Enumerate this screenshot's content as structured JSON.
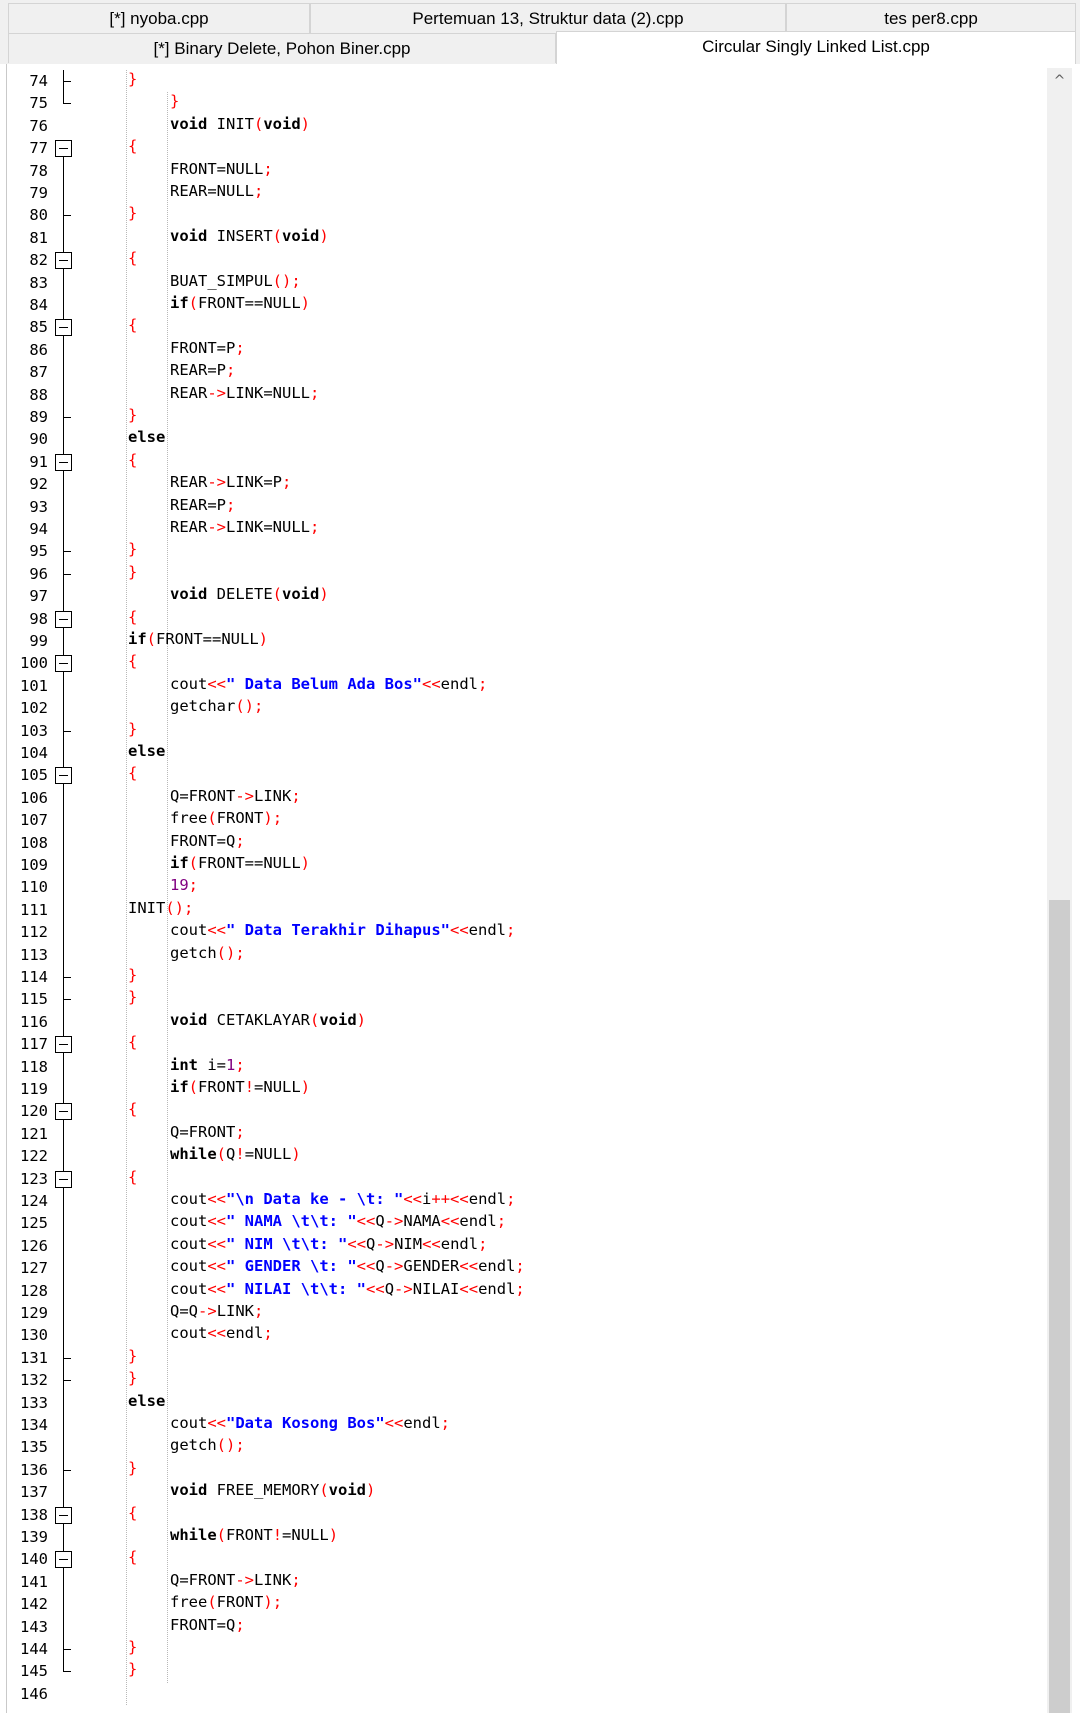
{
  "tabs": {
    "row1": [
      "[*] nyoba.cpp",
      "Pertemuan 13, Struktur data (2).cpp",
      "tes per8.cpp"
    ],
    "row2": [
      "[*] Binary Delete, Pohon Biner.cpp",
      "Circular Singly Linked List.cpp"
    ],
    "active": "Circular Singly Linked List.cpp"
  },
  "scrollbar": {
    "up_arrow": "^"
  },
  "editor": {
    "first_line_number": 74,
    "lines": [
      {
        "n": 74,
        "indent": 1,
        "text": "}"
      },
      {
        "n": 75,
        "indent": 2,
        "text": "}"
      },
      {
        "n": 76,
        "indent": 2,
        "text": "void INIT(void)"
      },
      {
        "n": 77,
        "indent": 1,
        "text": "{"
      },
      {
        "n": 78,
        "indent": 2,
        "text": "FRONT=NULL;"
      },
      {
        "n": 79,
        "indent": 2,
        "text": "REAR=NULL;"
      },
      {
        "n": 80,
        "indent": 1,
        "text": "}"
      },
      {
        "n": 81,
        "indent": 2,
        "text": "void INSERT(void)"
      },
      {
        "n": 82,
        "indent": 1,
        "text": "{"
      },
      {
        "n": 83,
        "indent": 2,
        "text": "BUAT_SIMPUL();"
      },
      {
        "n": 84,
        "indent": 2,
        "text": "if(FRONT==NULL)"
      },
      {
        "n": 85,
        "indent": 1,
        "text": "{"
      },
      {
        "n": 86,
        "indent": 2,
        "text": "FRONT=P;"
      },
      {
        "n": 87,
        "indent": 2,
        "text": "REAR=P;"
      },
      {
        "n": 88,
        "indent": 2,
        "text": "REAR->LINK=NULL;"
      },
      {
        "n": 89,
        "indent": 1,
        "text": "}"
      },
      {
        "n": 90,
        "indent": 1,
        "text": "else"
      },
      {
        "n": 91,
        "indent": 1,
        "text": "{"
      },
      {
        "n": 92,
        "indent": 2,
        "text": "REAR->LINK=P;"
      },
      {
        "n": 93,
        "indent": 2,
        "text": "REAR=P;"
      },
      {
        "n": 94,
        "indent": 2,
        "text": "REAR->LINK=NULL;"
      },
      {
        "n": 95,
        "indent": 1,
        "text": "}"
      },
      {
        "n": 96,
        "indent": 1,
        "text": "}"
      },
      {
        "n": 97,
        "indent": 2,
        "text": "void DELETE(void)"
      },
      {
        "n": 98,
        "indent": 1,
        "text": "{"
      },
      {
        "n": 99,
        "indent": 1,
        "text": "if(FRONT==NULL)"
      },
      {
        "n": 100,
        "indent": 1,
        "text": "{"
      },
      {
        "n": 101,
        "indent": 2,
        "text": "cout<<\" Data Belum Ada Bos\"<<endl;"
      },
      {
        "n": 102,
        "indent": 2,
        "text": "getchar();"
      },
      {
        "n": 103,
        "indent": 1,
        "text": "}"
      },
      {
        "n": 104,
        "indent": 1,
        "text": "else"
      },
      {
        "n": 105,
        "indent": 1,
        "text": "{"
      },
      {
        "n": 106,
        "indent": 2,
        "text": "Q=FRONT->LINK;"
      },
      {
        "n": 107,
        "indent": 2,
        "text": "free(FRONT);"
      },
      {
        "n": 108,
        "indent": 2,
        "text": "FRONT=Q;"
      },
      {
        "n": 109,
        "indent": 2,
        "text": "if(FRONT==NULL)"
      },
      {
        "n": 110,
        "indent": 2,
        "text": "19;"
      },
      {
        "n": 111,
        "indent": 1,
        "text": "INIT();"
      },
      {
        "n": 112,
        "indent": 2,
        "text": "cout<<\" Data Terakhir Dihapus\"<<endl;"
      },
      {
        "n": 113,
        "indent": 2,
        "text": "getch();"
      },
      {
        "n": 114,
        "indent": 1,
        "text": "}"
      },
      {
        "n": 115,
        "indent": 1,
        "text": "}"
      },
      {
        "n": 116,
        "indent": 2,
        "text": "void CETAKLAYAR(void)"
      },
      {
        "n": 117,
        "indent": 1,
        "text": "{"
      },
      {
        "n": 118,
        "indent": 2,
        "text": "int i=1;"
      },
      {
        "n": 119,
        "indent": 2,
        "text": "if(FRONT!=NULL)"
      },
      {
        "n": 120,
        "indent": 1,
        "text": "{"
      },
      {
        "n": 121,
        "indent": 2,
        "text": "Q=FRONT;"
      },
      {
        "n": 122,
        "indent": 2,
        "text": "while(Q!=NULL)"
      },
      {
        "n": 123,
        "indent": 1,
        "text": "{"
      },
      {
        "n": 124,
        "indent": 2,
        "text": "cout<<\"\\n Data ke - \\t: \"<<i++<<endl;"
      },
      {
        "n": 125,
        "indent": 2,
        "text": "cout<<\" NAMA \\t\\t: \"<<Q->NAMA<<endl;"
      },
      {
        "n": 126,
        "indent": 2,
        "text": "cout<<\" NIM \\t\\t: \"<<Q->NIM<<endl;"
      },
      {
        "n": 127,
        "indent": 2,
        "text": "cout<<\" GENDER \\t: \"<<Q->GENDER<<endl;"
      },
      {
        "n": 128,
        "indent": 2,
        "text": "cout<<\" NILAI \\t\\t: \"<<Q->NILAI<<endl;"
      },
      {
        "n": 129,
        "indent": 2,
        "text": "Q=Q->LINK;"
      },
      {
        "n": 130,
        "indent": 2,
        "text": "cout<<endl;"
      },
      {
        "n": 131,
        "indent": 1,
        "text": "}"
      },
      {
        "n": 132,
        "indent": 1,
        "text": "}"
      },
      {
        "n": 133,
        "indent": 1,
        "text": "else"
      },
      {
        "n": 134,
        "indent": 2,
        "text": "cout<<\"Data Kosong Bos\"<<endl;"
      },
      {
        "n": 135,
        "indent": 2,
        "text": "getch();"
      },
      {
        "n": 136,
        "indent": 1,
        "text": "}"
      },
      {
        "n": 137,
        "indent": 2,
        "text": "void FREE_MEMORY(void)"
      },
      {
        "n": 138,
        "indent": 1,
        "text": "{"
      },
      {
        "n": 139,
        "indent": 2,
        "text": "while(FRONT!=NULL)"
      },
      {
        "n": 140,
        "indent": 1,
        "text": "{"
      },
      {
        "n": 141,
        "indent": 2,
        "text": "Q=FRONT->LINK;"
      },
      {
        "n": 142,
        "indent": 2,
        "text": "free(FRONT);"
      },
      {
        "n": 143,
        "indent": 2,
        "text": "FRONT=Q;"
      },
      {
        "n": 144,
        "indent": 1,
        "text": "}"
      },
      {
        "n": 145,
        "indent": 1,
        "text": "}"
      },
      {
        "n": 146,
        "indent": 0,
        "text": ""
      }
    ],
    "fold_markers": {
      "77": "box",
      "82": "box",
      "85": "box",
      "91": "box",
      "98": "box",
      "100": "box",
      "105": "box",
      "117": "box",
      "120": "box",
      "123": "box",
      "138": "box",
      "140": "box",
      "74": "tee",
      "89": "tee",
      "95": "tee",
      "103": "tee",
      "114": "tee",
      "131": "tee",
      "132": "tee",
      "144": "tee",
      "75": "end",
      "80": "end",
      "96": "end",
      "115": "end",
      "136": "end",
      "145": "end"
    }
  }
}
